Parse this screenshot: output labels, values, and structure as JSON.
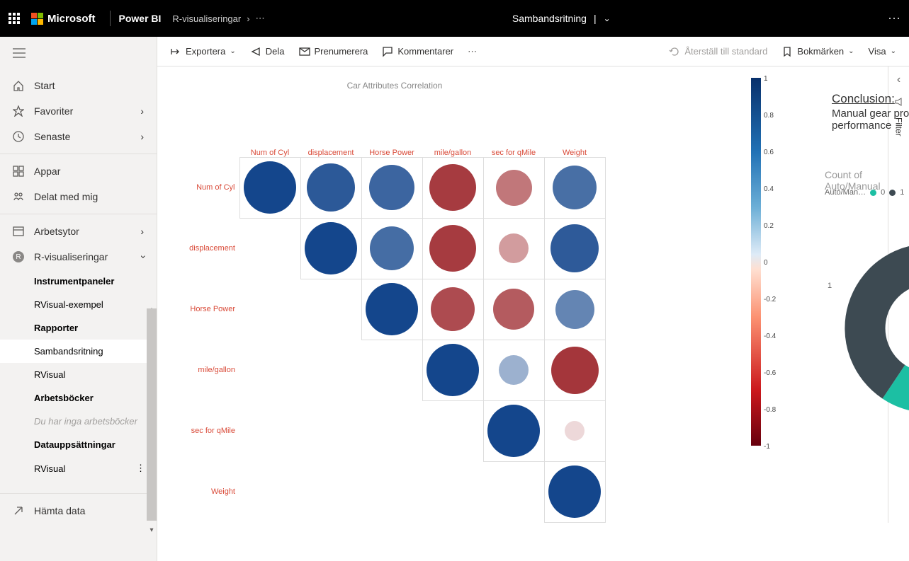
{
  "top": {
    "microsoft": "Microsoft",
    "brand": "Power BI",
    "workspace": "R-visualiseringar",
    "title": "Sambandsritning"
  },
  "toolbar": {
    "export": "Exportera",
    "share": "Dela",
    "subscribe": "Prenumerera",
    "comments": "Kommentarer",
    "reset": "Återställ till standard",
    "bookmarks": "Bokmärken",
    "view": "Visa"
  },
  "sidebar": {
    "home": "Start",
    "favorites": "Favoriter",
    "recent": "Senaste",
    "apps": "Appar",
    "shared": "Delat med mig",
    "workspaces": "Arbetsytor",
    "currentWs": "R-visualiseringar",
    "dashboards": "Instrumentpaneler",
    "rvexample": "RVisual-exempel",
    "reports": "Rapporter",
    "sambands": "Sambandsritning",
    "rvisual": "RVisual",
    "workbooks": "Arbetsböcker",
    "noWorkbooks": "Du har inga arbetsböcker",
    "datasets": "Datauppsättningar",
    "rvisual2": "RVisual",
    "getdata": "Hämta data"
  },
  "report": {
    "chartTitle": "Car Attributes Correlation",
    "conclusionHead": "Conclusion:",
    "conclusionText": "Manual gear provides better performance",
    "donutTitle": "Count of Auto/Manual",
    "legendLabel": "Auto/Man…",
    "legend0": "0",
    "legend1": "1",
    "donutLab0": "0",
    "donutLab1": "1"
  },
  "filter": {
    "label": "Filter"
  },
  "chart_data": [
    {
      "type": "heatmap",
      "title": "Car Attributes Correlation",
      "labels": [
        "Num of Cyl",
        "displacement",
        "Horse Power",
        "mile/gallon",
        "sec for qMile",
        "Weight"
      ],
      "matrix": [
        [
          1.0,
          0.9,
          0.83,
          -0.85,
          -0.59,
          0.78
        ],
        [
          null,
          1.0,
          0.79,
          -0.85,
          -0.43,
          0.89
        ],
        [
          null,
          null,
          1.0,
          -0.78,
          -0.71,
          0.66
        ],
        [
          null,
          null,
          null,
          1.0,
          0.42,
          -0.87
        ],
        [
          null,
          null,
          null,
          null,
          1.0,
          -0.17
        ],
        [
          null,
          null,
          null,
          null,
          null,
          1.0
        ]
      ],
      "scale_ticks": [
        1,
        0.8,
        0.6,
        0.4,
        0.2,
        0,
        -0.2,
        -0.4,
        -0.6,
        -0.8,
        -1
      ]
    },
    {
      "type": "pie",
      "title": "Count of Auto/Manual",
      "series": [
        {
          "name": "0",
          "value": 19,
          "color": "#1cbfa3"
        },
        {
          "name": "1",
          "value": 13,
          "color": "#3d4a52"
        }
      ]
    }
  ]
}
